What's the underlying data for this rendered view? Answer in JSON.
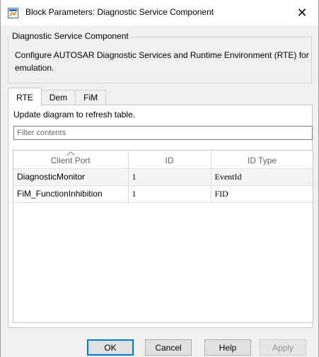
{
  "window": {
    "title": "Block Parameters: Diagnostic Service Component",
    "close_glyph": "✕"
  },
  "group": {
    "legend": "Diagnostic Service Component",
    "description": "Configure AUTOSAR Diagnostic Services and Runtime Environment (RTE) for emulation."
  },
  "tabs": [
    {
      "label": "RTE",
      "active": true
    },
    {
      "label": "Dem",
      "active": false
    },
    {
      "label": "FiM",
      "active": false
    }
  ],
  "panel": {
    "info": "Update diagram to refresh table.",
    "filter_placeholder": "Filter contents"
  },
  "table": {
    "columns": [
      "Client Port",
      "ID",
      "ID Type"
    ],
    "sort_indicator": "sort-ascending-icon",
    "rows": [
      [
        "DiagnosticMonitor",
        "1",
        "EventId"
      ],
      [
        "FiM_FunctionInhibition",
        "1",
        "FID"
      ]
    ]
  },
  "buttons": {
    "ok": "OK",
    "cancel": "Cancel",
    "help": "Help",
    "apply": "Apply"
  },
  "colors": {
    "accent": "#0078d7",
    "icon_orange": "#e87b1c",
    "icon_blue": "#2a6ebf"
  }
}
